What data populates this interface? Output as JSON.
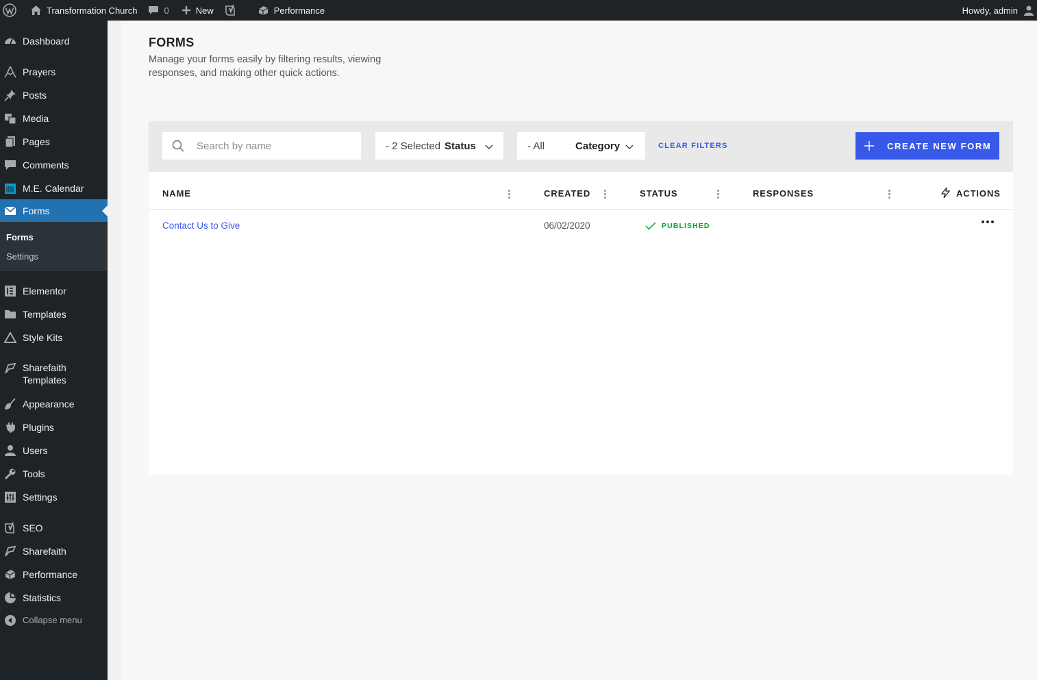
{
  "admin_bar": {
    "site_name": "Transformation Church",
    "comments_count": "0",
    "new_label": "New",
    "performance_label": "Performance",
    "greeting": "Howdy, admin",
    "icons": [
      "wordpress-logo-icon",
      "home-icon",
      "comment-icon",
      "plus-icon",
      "yoast-icon",
      "performance-icon",
      "user-avatar-icon"
    ]
  },
  "sidebar": {
    "items": [
      {
        "label": "Dashboard",
        "icon": "dashboard-icon"
      },
      {
        "label": "Prayers",
        "icon": "prayers-icon"
      },
      {
        "label": "Posts",
        "icon": "pin-icon"
      },
      {
        "label": "Media",
        "icon": "media-icon"
      },
      {
        "label": "Pages",
        "icon": "pages-icon"
      },
      {
        "label": "Comments",
        "icon": "comment-icon"
      },
      {
        "label": "M.E. Calendar",
        "icon": "calendar-icon"
      },
      {
        "label": "Forms",
        "icon": "envelope-icon"
      },
      {
        "label": "Elementor",
        "icon": "elementor-icon"
      },
      {
        "label": "Templates",
        "icon": "folder-icon"
      },
      {
        "label": "Style Kits",
        "icon": "triangle-icon"
      },
      {
        "label": "Sharefaith Templates",
        "label_line1": "Sharefaith",
        "label_line2": "Templates",
        "icon": "sharefaith-icon"
      },
      {
        "label": "Appearance",
        "icon": "brush-icon"
      },
      {
        "label": "Plugins",
        "icon": "plugin-icon"
      },
      {
        "label": "Users",
        "icon": "users-icon"
      },
      {
        "label": "Tools",
        "icon": "wrench-icon"
      },
      {
        "label": "Settings",
        "icon": "settings-icon"
      },
      {
        "label": "SEO",
        "icon": "yoast-icon"
      },
      {
        "label": "Sharefaith",
        "icon": "sharefaith-icon"
      },
      {
        "label": "Performance",
        "icon": "performance-icon"
      },
      {
        "label": "Statistics",
        "icon": "pie-chart-icon"
      }
    ],
    "submenu": [
      {
        "label": "Forms",
        "current": true
      },
      {
        "label": "Settings",
        "current": false
      }
    ],
    "collapse_label": "Collapse menu",
    "active_color": "#2271b1"
  },
  "page": {
    "title": "FORMS",
    "description": "Manage your forms easily by filtering results, viewing responses, and making other quick actions."
  },
  "filters": {
    "search_placeholder": "Search by name",
    "status_prefix": "- 2 Selected",
    "status_label": "Status",
    "category_prefix": "- All",
    "category_label": "Category",
    "clear_label": "CLEAR FILTERS",
    "create_label": "CREATE NEW FORM",
    "accent_color": "#3858e9"
  },
  "table": {
    "columns": [
      "NAME",
      "CREATED",
      "STATUS",
      "RESPONSES",
      "ACTIONS"
    ],
    "rows": [
      {
        "name": "Contact Us to Give",
        "created": "06/02/2020",
        "status": "PUBLISHED",
        "responses": ""
      }
    ],
    "status_color": "#00a32a"
  }
}
